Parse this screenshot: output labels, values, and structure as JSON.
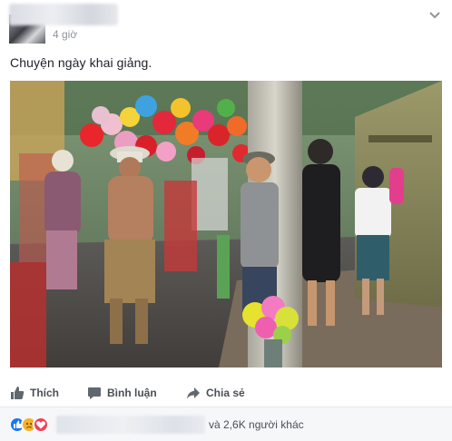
{
  "post": {
    "timestamp": "4 giờ",
    "caption": "Chuyện ngày khai giảng.",
    "photo_icon": "street-photo-balloons-children",
    "menu_icon": "chevron-down-icon"
  },
  "actions": {
    "like_label": "Thích",
    "comment_label": "Bình luận",
    "share_label": "Chia sẻ"
  },
  "reactions": {
    "others_text": "và 2,6K người khác",
    "types": [
      "like",
      "sad",
      "love"
    ]
  },
  "colors": {
    "like_blue": "#1877f2",
    "sad_yellow": "#f7b125",
    "love_red": "#f33e58",
    "action_gray": "#4b4f56",
    "meta_gray": "#90949c"
  }
}
